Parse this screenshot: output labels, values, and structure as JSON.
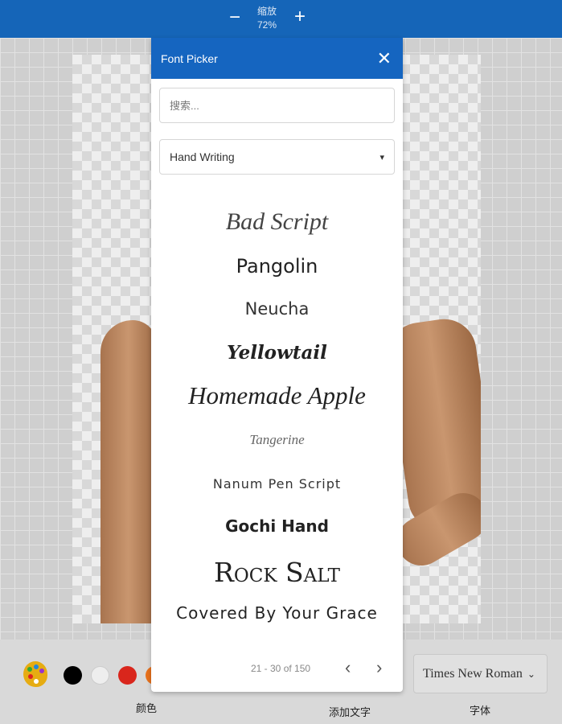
{
  "topbar": {
    "zoom_label": "缩放",
    "zoom_value": "72%",
    "minus": "−",
    "plus": "+"
  },
  "font_picker": {
    "title": "Font Picker",
    "close": "✕",
    "search_placeholder": "搜索...",
    "category": "Hand Writing",
    "fonts": [
      "Bad Script",
      "Pangolin",
      "Neucha",
      "Yellowtail",
      "Homemade Apple",
      "Tangerine",
      "Nanum Pen Script",
      "Gochi Hand",
      "Rock Salt",
      "Covered By Your Grace"
    ],
    "pagination": "21 - 30 of 150",
    "prev": "‹",
    "next": "›"
  },
  "bottombar": {
    "colors": [
      "#000000",
      "#eeeeee",
      "#d9261c",
      "#e8711c"
    ],
    "color_label": "颜色",
    "add_text_label": "添加文字",
    "font_label": "字体",
    "current_font": "Times New Roman"
  }
}
